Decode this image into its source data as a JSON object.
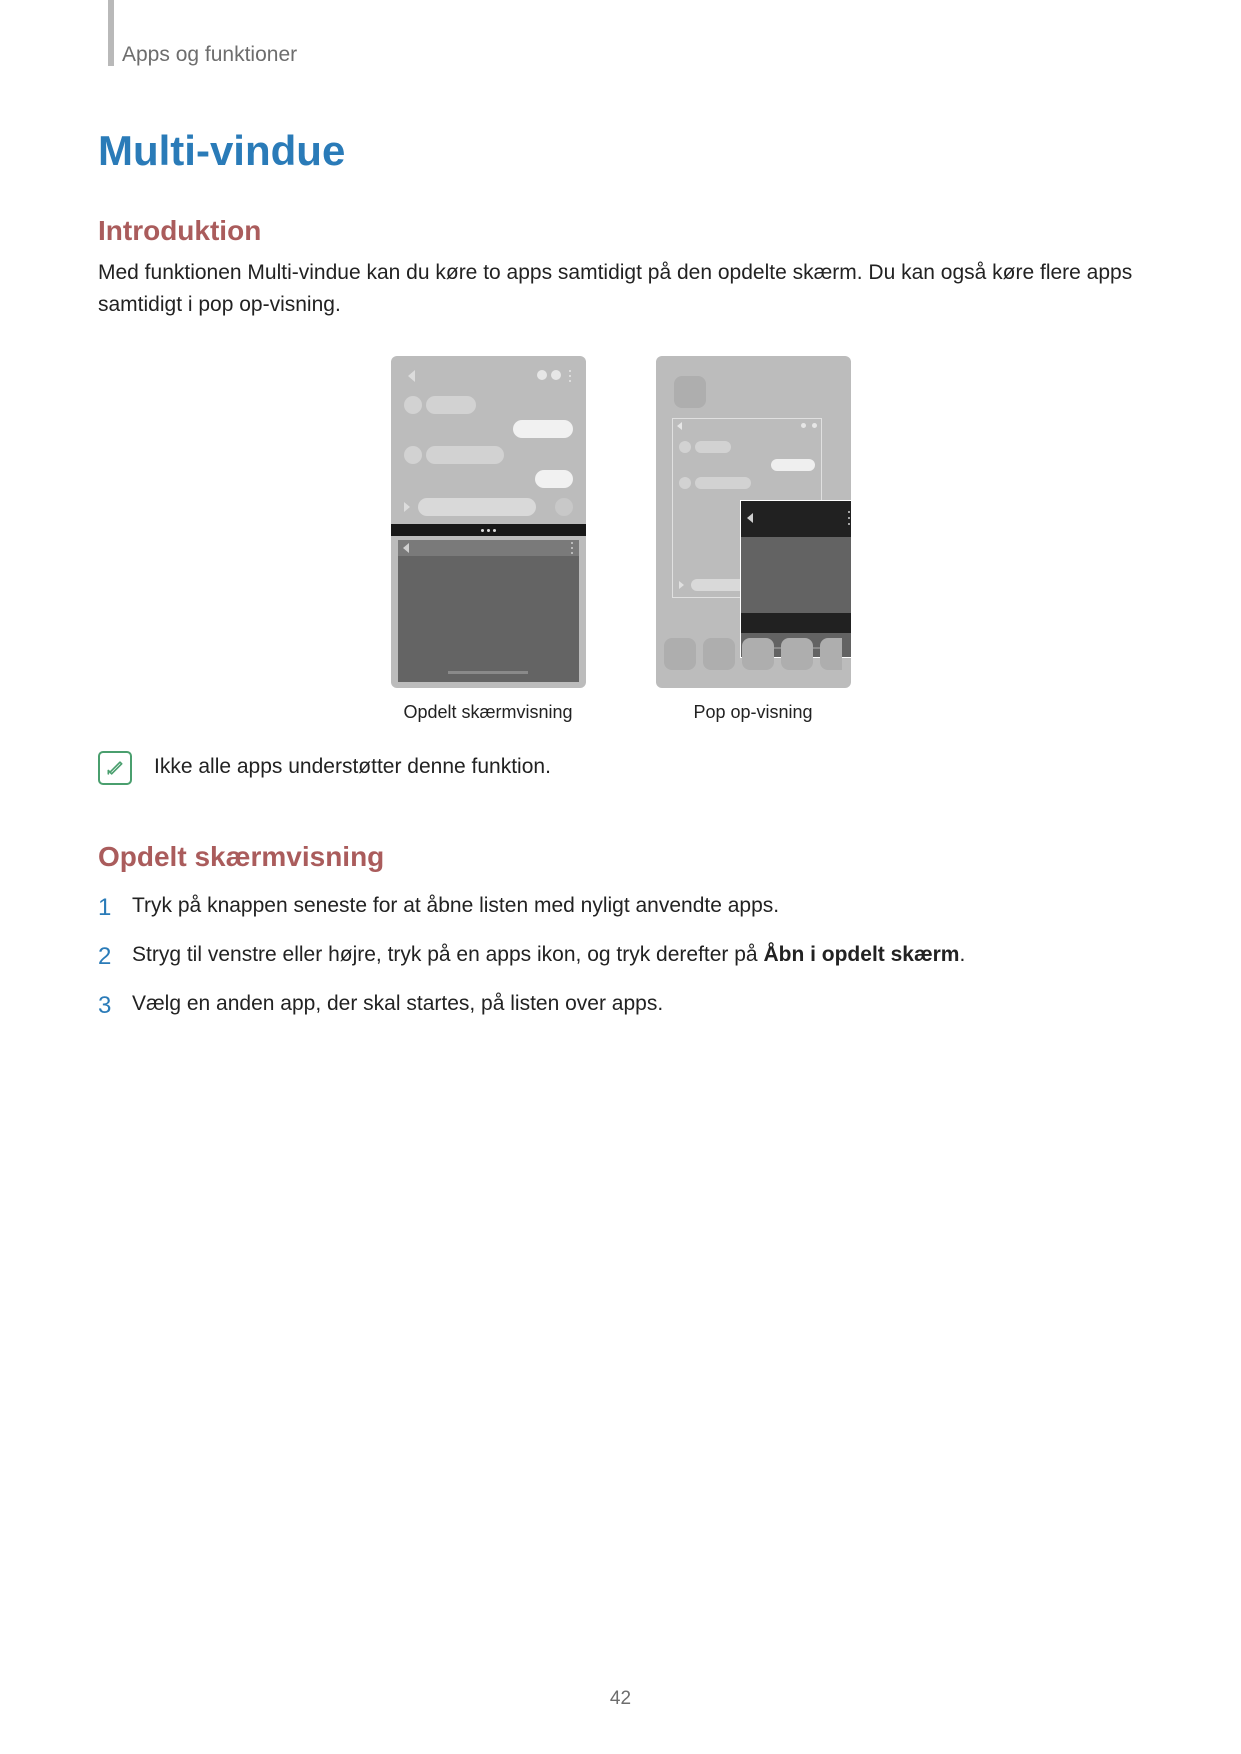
{
  "breadcrumb": "Apps og funktioner",
  "title": "Multi-vindue",
  "intro": {
    "heading": "Introduktion",
    "text": "Med funktionen Multi-vindue kan du køre to apps samtidigt på den opdelte skærm. Du kan også køre flere apps samtidigt i pop op-visning."
  },
  "captions": {
    "left": "Opdelt skærmvisning",
    "right": "Pop op-visning"
  },
  "note": "Ikke alle apps understøtter denne funktion.",
  "split": {
    "heading": "Opdelt skærmvisning",
    "steps": [
      {
        "n": "1",
        "text_before": "Tryk på knappen seneste for at åbne listen med nyligt anvendte apps.",
        "bold": "",
        "text_after": ""
      },
      {
        "n": "2",
        "text_before": "Stryg til venstre eller højre, tryk på en apps ikon, og tryk derefter på ",
        "bold": "Åbn i opdelt skærm",
        "text_after": "."
      },
      {
        "n": "3",
        "text_before": "Vælg en anden app, der skal startes, på listen over apps.",
        "bold": "",
        "text_after": ""
      }
    ]
  },
  "page_number": "42"
}
